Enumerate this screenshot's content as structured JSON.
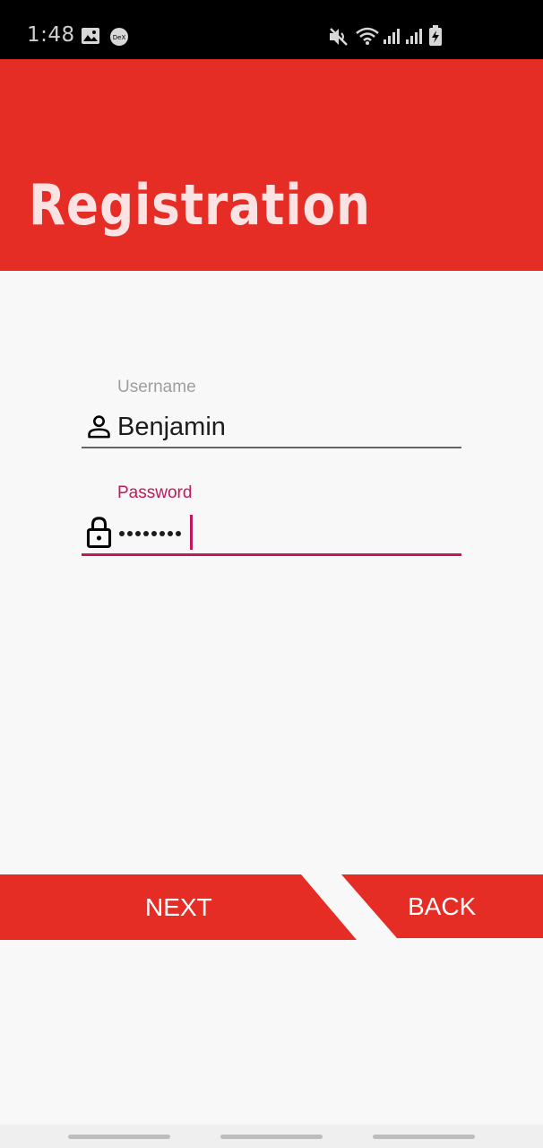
{
  "status_bar": {
    "time": "1:48",
    "icons": [
      "gallery-icon",
      "dex-icon",
      "mute-icon",
      "wifi-icon",
      "signal-icon",
      "signal-icon",
      "battery-charging-icon"
    ]
  },
  "header": {
    "title": "Registration",
    "background_color": "#e52d26"
  },
  "form": {
    "username": {
      "label": "Username",
      "value": "Benjamin",
      "icon": "person-icon"
    },
    "password": {
      "label": "Password",
      "masked_length": 8,
      "icon": "lock-icon",
      "focused": true,
      "accent_color": "#c2185b"
    }
  },
  "buttons": {
    "next_label": "NEXT",
    "back_label": "BACK",
    "color": "#e52d26"
  },
  "nav_bar": {
    "pills": 3
  }
}
